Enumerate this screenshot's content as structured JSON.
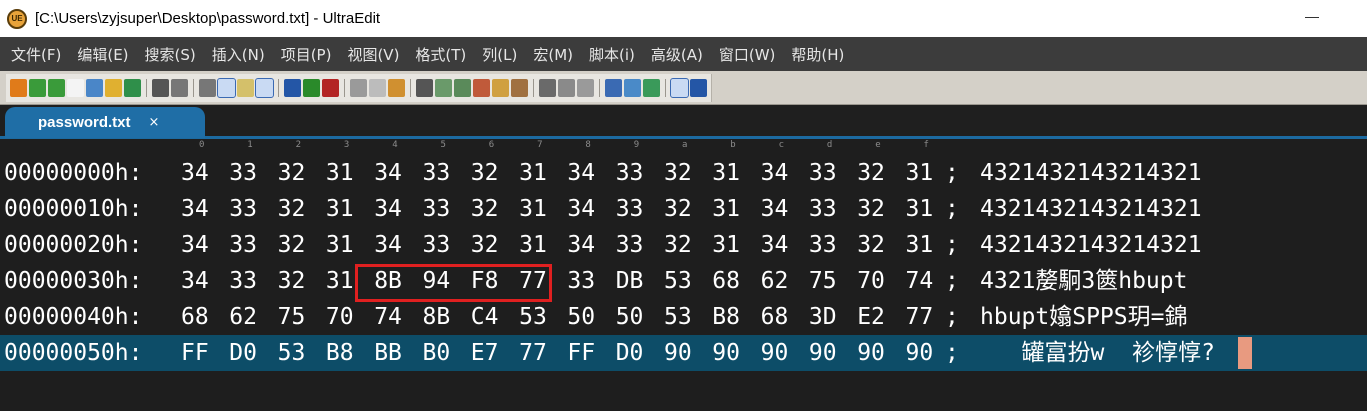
{
  "window": {
    "title": "[C:\\Users\\zyjsuper\\Desktop\\password.txt] - UltraEdit",
    "app_icon_text": "UE"
  },
  "menu": [
    "文件(F)",
    "编辑(E)",
    "搜索(S)",
    "插入(N)",
    "项目(P)",
    "视图(V)",
    "格式(T)",
    "列(L)",
    "宏(M)",
    "脚本(i)",
    "高级(A)",
    "窗口(W)",
    "帮助(H)"
  ],
  "toolbar_icons": [
    "new-file-icon",
    "back-icon",
    "forward-icon",
    "file-icon",
    "open-icon",
    "open-folder-icon",
    "save-icon",
    "print-icon",
    "print-preview-icon",
    "page-icon",
    "hex-mode-icon",
    "column-icon",
    "list-icon",
    "user-tool-1-icon",
    "user-tool-2-icon",
    "user-tool-3-icon",
    "cut-icon",
    "copy-icon",
    "paste-icon",
    "find-icon",
    "replace-icon",
    "find-next-icon",
    "bookmark-icon",
    "macro-icon",
    "macro-play-icon",
    "window-1-icon",
    "window-2-icon",
    "window-3-icon",
    "web-icon",
    "ftp-icon",
    "refresh-icon",
    "layout-icon",
    "help-icon"
  ],
  "tab": {
    "label": "password.txt",
    "close": "×"
  },
  "ruler": [
    "0",
    "1",
    "2",
    "3",
    "4",
    "5",
    "6",
    "7",
    "8",
    "9",
    "a",
    "b",
    "c",
    "d",
    "e",
    "f"
  ],
  "hex_rows": [
    {
      "address": "00000000h:",
      "bytes": [
        "34",
        "33",
        "32",
        "31",
        "34",
        "33",
        "32",
        "31",
        "34",
        "33",
        "32",
        "31",
        "34",
        "33",
        "32",
        "31"
      ],
      "separator": ";",
      "ascii": "4321432143214321"
    },
    {
      "address": "00000010h:",
      "bytes": [
        "34",
        "33",
        "32",
        "31",
        "34",
        "33",
        "32",
        "31",
        "34",
        "33",
        "32",
        "31",
        "34",
        "33",
        "32",
        "31"
      ],
      "separator": ";",
      "ascii": "4321432143214321"
    },
    {
      "address": "00000020h:",
      "bytes": [
        "34",
        "33",
        "32",
        "31",
        "34",
        "33",
        "32",
        "31",
        "34",
        "33",
        "32",
        "31",
        "34",
        "33",
        "32",
        "31"
      ],
      "separator": ";",
      "ascii": "4321432143214321"
    },
    {
      "address": "00000030h:",
      "bytes": [
        "34",
        "33",
        "32",
        "31",
        "8B",
        "94",
        "F8",
        "77",
        "33",
        "DB",
        "53",
        "68",
        "62",
        "75",
        "70",
        "74"
      ],
      "separator": ";",
      "ascii": "4321嫠駉3篋hbupt"
    },
    {
      "address": "00000040h:",
      "bytes": [
        "68",
        "62",
        "75",
        "70",
        "74",
        "8B",
        "C4",
        "53",
        "50",
        "50",
        "53",
        "B8",
        "68",
        "3D",
        "E2",
        "77"
      ],
      "separator": ";",
      "ascii": "hbupt嬆SPPS玥=錦"
    },
    {
      "address": "00000050h:",
      "bytes": [
        "FF",
        "D0",
        "53",
        "B8",
        "BB",
        "B0",
        "E7",
        "77",
        "FF",
        "D0",
        "90",
        "90",
        "90",
        "90",
        "90",
        "90"
      ],
      "separator": ";",
      "ascii": "   罐富扮w  袗惇惇?"
    }
  ],
  "colors": {
    "editor_bg": "#1e1e1e",
    "text": "#ffffff",
    "selected_row": "#0d4d68",
    "tab_active": "#1f6ea6",
    "annotation_box": "#e02020",
    "cursor": "#e89a80"
  }
}
